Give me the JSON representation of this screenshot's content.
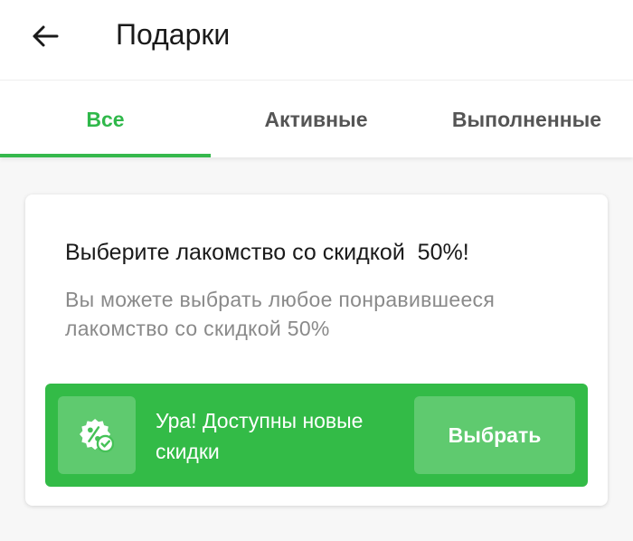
{
  "header": {
    "title": "Подарки",
    "back_icon": "arrow-left-icon"
  },
  "tabs": [
    {
      "label": "Все",
      "active": true
    },
    {
      "label": "Активные",
      "active": false
    },
    {
      "label": "Выполненные",
      "active": false
    }
  ],
  "offer": {
    "title": "Выберите лакомство со скидкой  50%!",
    "description": "Вы можете выбрать любое понравившееся лакомство со скидкой 50%",
    "promo": {
      "icon": "discount-badge-icon",
      "text": "Ура! Доступны новые скидки",
      "button_label": "Выбрать"
    }
  },
  "colors": {
    "accent": "#33bb47",
    "tab_active_text": "#2fb84a",
    "tab_inactive_text": "#555555"
  }
}
